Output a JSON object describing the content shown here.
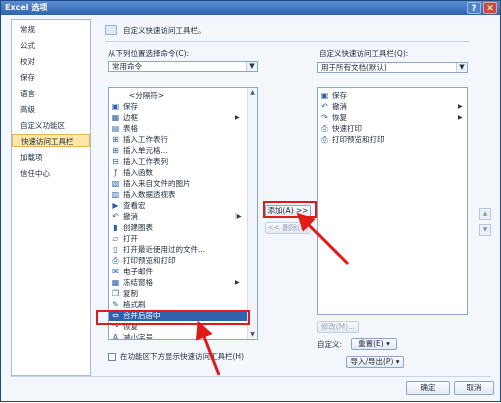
{
  "window": {
    "title": "Excel 选项",
    "help": "?",
    "close": "✕"
  },
  "sidebar": {
    "items": [
      {
        "label": "常规"
      },
      {
        "label": "公式"
      },
      {
        "label": "校对"
      },
      {
        "label": "保存"
      },
      {
        "label": "语言"
      },
      {
        "label": "高级"
      },
      {
        "label": "自定义功能区"
      },
      {
        "label": "快速访问工具栏",
        "selected": true
      },
      {
        "label": "加载项"
      },
      {
        "label": "信任中心"
      }
    ]
  },
  "main": {
    "heading": "自定义快速访问工具栏。",
    "choose_from_label": "从下列位置选择命令(C):",
    "choose_from_value": "常用命令",
    "customize_label": "自定义快速访问工具栏(Q):",
    "customize_value": "用于所有文档(默认)",
    "commands": [
      {
        "icon": "",
        "label": "<分隔符>"
      },
      {
        "icon": "save-icon",
        "label": "保存"
      },
      {
        "icon": "border-icon",
        "label": "边框",
        "submenu": true
      },
      {
        "icon": "table-icon",
        "label": "表格"
      },
      {
        "icon": "insert-row-icon",
        "label": "插入工作表行"
      },
      {
        "icon": "insert-cell-icon",
        "label": "插入单元格..."
      },
      {
        "icon": "insert-column-icon",
        "label": "插入工作表列"
      },
      {
        "icon": "function-icon",
        "label": "插入函数"
      },
      {
        "icon": "picture-icon",
        "label": "插入来自文件的图片"
      },
      {
        "icon": "pivot-icon",
        "label": "插入数据透视表"
      },
      {
        "icon": "play-icon",
        "label": "查看宏"
      },
      {
        "icon": "undo-icon",
        "label": "撤消",
        "submenu": true
      },
      {
        "icon": "chart-icon",
        "label": "创建图表"
      },
      {
        "icon": "folder-icon",
        "label": "打开"
      },
      {
        "icon": "recent-file-icon",
        "label": "打开最近使用过的文件..."
      },
      {
        "icon": "print-preview-icon",
        "label": "打印预览和打印"
      },
      {
        "icon": "email-icon",
        "label": "电子邮件"
      },
      {
        "icon": "freeze-pane-icon",
        "label": "冻结窗格",
        "submenu": true
      },
      {
        "icon": "copy-icon",
        "label": "复制"
      },
      {
        "icon": "format-painter-icon",
        "label": "格式刷"
      },
      {
        "icon": "merge-center-icon",
        "label": "合并后居中",
        "highlighted": true
      },
      {
        "icon": "redo-icon",
        "label": "恢复"
      },
      {
        "icon": "decrease-font-icon",
        "label": "减小字号"
      }
    ],
    "qat_items": [
      {
        "icon": "save-icon",
        "label": "保存"
      },
      {
        "icon": "undo-icon",
        "label": "撤消",
        "submenu": true
      },
      {
        "icon": "redo-icon",
        "label": "恢复",
        "submenu": true
      },
      {
        "icon": "quick-print-icon",
        "label": "快速打印"
      },
      {
        "icon": "print-preview-icon",
        "label": "打印预览和打印"
      }
    ],
    "add_button": "添加(A) >>",
    "remove_button": "<< 删除(R)",
    "modify_button": "修改(M)...",
    "customize_text": "自定义:",
    "reset_button": "重置(E) ▾",
    "import_export_button": "导入/导出(P) ▾",
    "show_below_label": "在功能区下方显示快速访问工具栏(H)"
  },
  "footer": {
    "ok": "确定",
    "cancel": "取消"
  },
  "colors": {
    "annotation": "#e11a1a",
    "selection": "#2f63ad",
    "nav_selected": "#fce7a8"
  }
}
